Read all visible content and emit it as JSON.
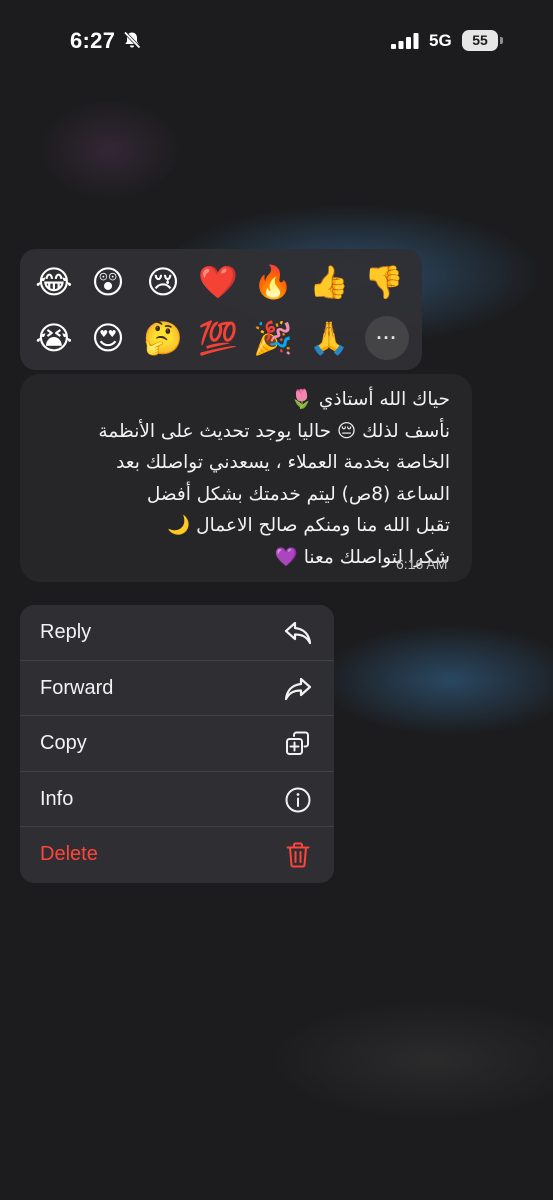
{
  "status_bar": {
    "time": "6:27",
    "network": "5G",
    "battery": "55",
    "icons": [
      "bell-slash-icon",
      "signal-icon",
      "battery-icon"
    ]
  },
  "reactions": [
    {
      "name": "joy",
      "emoji": "😂"
    },
    {
      "name": "astonished",
      "emoji": "😲"
    },
    {
      "name": "cry",
      "emoji": "😢"
    },
    {
      "name": "heart",
      "emoji": "❤️"
    },
    {
      "name": "fire",
      "emoji": "🔥"
    },
    {
      "name": "thumbs-up",
      "emoji": "👍"
    },
    {
      "name": "thumbs-down",
      "emoji": "👎"
    },
    {
      "name": "sob",
      "emoji": "😭"
    },
    {
      "name": "heart-eyes",
      "emoji": "😍"
    },
    {
      "name": "thinking",
      "emoji": "🤔"
    },
    {
      "name": "hundred",
      "emoji": "💯"
    },
    {
      "name": "party-popper",
      "emoji": "🎉"
    },
    {
      "name": "pray",
      "emoji": "🙏"
    }
  ],
  "more_reactions_label": "···",
  "message": {
    "lines": [
      "حياك الله أستاذي 🌷",
      "نأسف لذلك 😔 حاليا يوجد تحديث على الأنظمة",
      "الخاصة بخدمة العملاء ، يسعدني تواصلك بعد",
      "الساعة (8ص) ليتم خدمتك بشكل أفضل",
      "تقبل الله منا ومنكم صالح الاعمال 🌙",
      "شكرا لتواصلك معنا 💜"
    ],
    "timestamp": "6:16 AM"
  },
  "menu": {
    "items": [
      {
        "label": "Reply",
        "icon": "reply-icon",
        "danger": false
      },
      {
        "label": "Forward",
        "icon": "forward-icon",
        "danger": false
      },
      {
        "label": "Copy",
        "icon": "copy-icon",
        "danger": false
      },
      {
        "label": "Info",
        "icon": "info-icon",
        "danger": false
      },
      {
        "label": "Delete",
        "icon": "trash-icon",
        "danger": true
      }
    ],
    "danger_color": "#ff453a"
  }
}
